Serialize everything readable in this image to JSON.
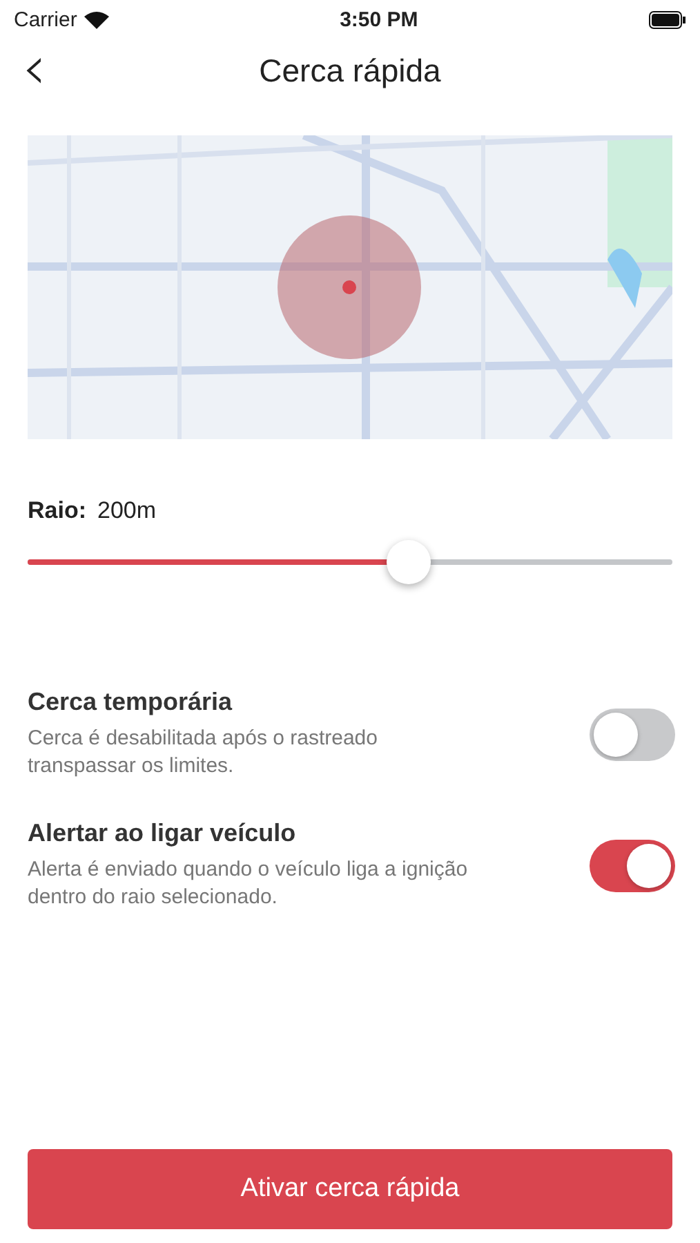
{
  "status_bar": {
    "carrier": "Carrier",
    "time": "3:50 PM"
  },
  "header": {
    "back": "‹",
    "title": "Cerca rápida"
  },
  "radius": {
    "label": "Raio:",
    "value": "200m",
    "level": 0.59
  },
  "settings": [
    {
      "title": "Cerca temporária",
      "description": "Cerca é desabilitada após o rastreado transpassar os limites.",
      "on": false
    },
    {
      "title": "Alertar ao ligar veículo",
      "description": "Alerta é enviado quando o veículo liga a ignição dentro do raio selecionado.",
      "on": true
    }
  ],
  "action_button": "Ativar cerca rápida"
}
